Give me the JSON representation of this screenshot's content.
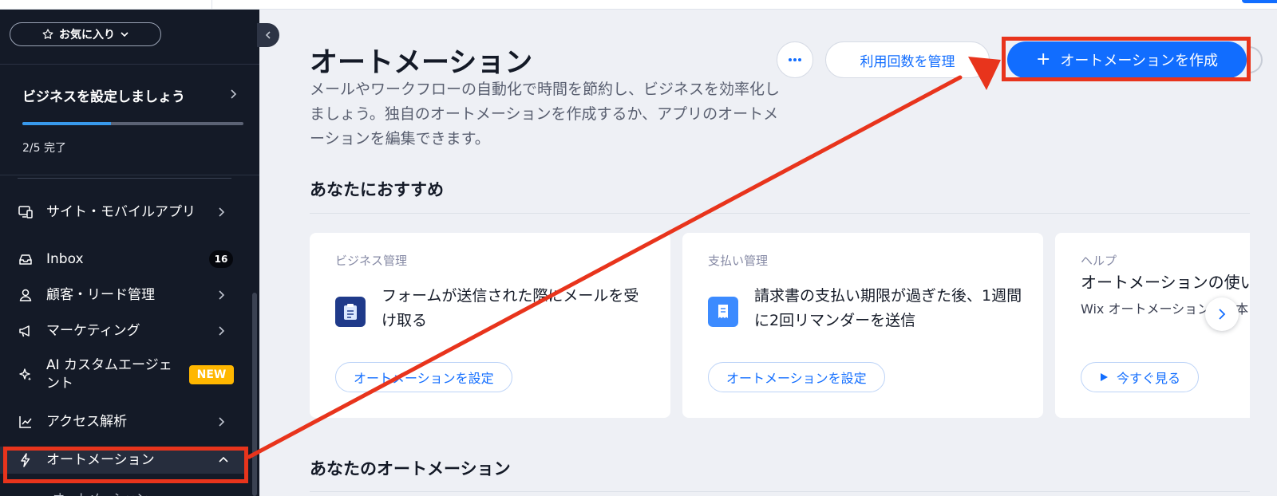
{
  "app": {
    "brand_color": "#116dff",
    "sidebar_bg": "#141a27",
    "annotation_color": "#e8341c"
  },
  "sidebar": {
    "favorites_label": "お気に入り",
    "setup": {
      "title": "ビジネスを設定しましょう",
      "progress_text": "2/5 完了",
      "progress_fraction": 0.4
    },
    "items": [
      {
        "label": "サイト・モバイルアプリ",
        "icon": "devices-icon"
      },
      {
        "label": "Inbox",
        "icon": "inbox-icon",
        "badge": "16"
      },
      {
        "label": "顧客・リード管理",
        "icon": "contacts-icon"
      },
      {
        "label": "マーケティング",
        "icon": "megaphone-icon"
      },
      {
        "label": "AI カスタムエージェント",
        "icon": "sparkle-icon",
        "badge": "NEW"
      },
      {
        "label": "アクセス解析",
        "icon": "chart-icon"
      },
      {
        "label": "オートメーション",
        "icon": "lightning-icon",
        "expanded": true
      }
    ],
    "sub_item_hint": "オートメーション"
  },
  "main": {
    "title": "オートメーション",
    "description": "メールやワークフローの自動化で時間を節約し、ビジネスを効率化しましょう。独自のオートメーションを作成するか、アプリのオートメーションを編集できます。",
    "more_icon": "more-dots-icon",
    "manage_button": "利用回数を管理",
    "create_button": "オートメーションを作成",
    "recommended": {
      "title": "あなたにおすすめ",
      "cards": [
        {
          "category": "ビジネス管理",
          "text": "フォームが送信された際にメールを受け取る",
          "button": "オートメーションを設定",
          "icon": "clipboard-icon"
        },
        {
          "category": "支払い管理",
          "text": "請求書の支払い期限が過ぎた後、1週間に2回リマンダーを送信",
          "button": "オートメーションを設定",
          "icon": "invoice-icon"
        },
        {
          "category": "ヘルプ",
          "title": "オートメーションの使い",
          "desc": "Wix オートメーションの基本（英語）をご覧ください",
          "button": "今すぐ見る",
          "icon": "play-icon"
        }
      ]
    },
    "my_automations_title": "あなたのオートメーション"
  }
}
